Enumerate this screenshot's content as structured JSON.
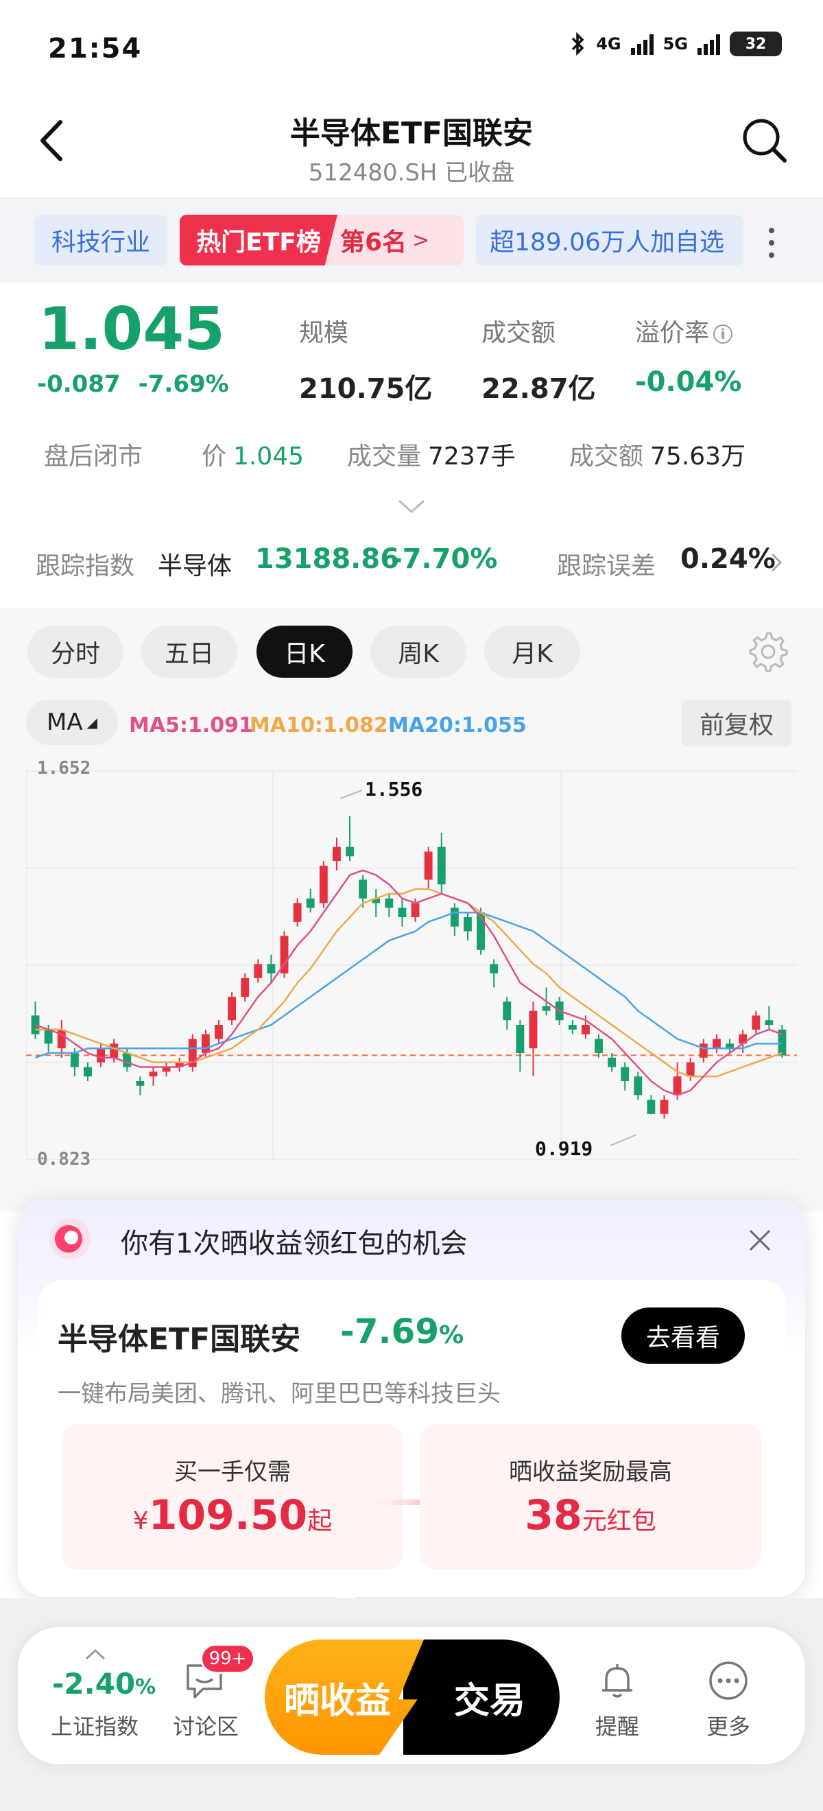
{
  "status": {
    "time": "21:54",
    "net1": "4G",
    "net2": "5G",
    "battery": "32"
  },
  "header": {
    "title": "半导体ETF国联安",
    "subtitle": "512480.SH 已收盘"
  },
  "tags": {
    "industry": "科技行业",
    "hot_label": "热门ETF榜",
    "rank": "第6名",
    "rank_arrow": ">",
    "watchers": "超189.06万人加自选"
  },
  "quote": {
    "price": "1.045",
    "change": "-0.087",
    "change_pct": "-7.69%",
    "scale_label": "规模",
    "scale_value": "210.75亿",
    "turnover_label": "成交额",
    "turnover_value": "22.87亿",
    "premium_label": "溢价率",
    "premium_value": "-0.04%"
  },
  "after_hours": {
    "title": "盘后闭市",
    "price_label": "价",
    "price_value": "1.045",
    "volume_label": "成交量",
    "volume_value": "7237手",
    "amount_label": "成交额",
    "amount_value": "75.63万"
  },
  "tracking": {
    "label": "跟踪指数",
    "index_name": "半导体",
    "index_value": "13188.86",
    "index_pct": "-7.70%",
    "error_label": "跟踪误差",
    "error_value": "0.24%"
  },
  "period_tabs": [
    {
      "label": "分时"
    },
    {
      "label": "五日"
    },
    {
      "label": "日K"
    },
    {
      "label": "周K"
    },
    {
      "label": "月K"
    }
  ],
  "ma_bar": {
    "button": "MA",
    "ma5": "MA5:1.091",
    "ma10": "MA10:1.082",
    "ma20": "MA20:1.055",
    "adjust": "前复权",
    "ma5_color": "#e0508a",
    "ma10_color": "#f0a94a",
    "ma20_color": "#4aa3e8"
  },
  "chart_labels": {
    "y_max": "1.652",
    "y_min": "0.823",
    "peak": "1.556",
    "trough": "0.919"
  },
  "chart_data": {
    "type": "candlestick",
    "ylim": [
      0.823,
      1.652
    ],
    "reference_price": 1.045,
    "candles": [
      {
        "o": 1.13,
        "c": 1.09,
        "h": 1.16,
        "l": 1.08
      },
      {
        "o": 1.1,
        "c": 1.07,
        "h": 1.11,
        "l": 1.05
      },
      {
        "o": 1.06,
        "c": 1.1,
        "h": 1.12,
        "l": 1.04
      },
      {
        "o": 1.05,
        "c": 1.02,
        "h": 1.06,
        "l": 1.0
      },
      {
        "o": 1.02,
        "c": 1.0,
        "h": 1.03,
        "l": 0.99
      },
      {
        "o": 1.03,
        "c": 1.06,
        "h": 1.07,
        "l": 1.02
      },
      {
        "o": 1.04,
        "c": 1.07,
        "h": 1.08,
        "l": 1.03
      },
      {
        "o": 1.05,
        "c": 1.02,
        "h": 1.06,
        "l": 1.01
      },
      {
        "o": 0.99,
        "c": 0.98,
        "h": 1.0,
        "l": 0.96
      },
      {
        "o": 1.0,
        "c": 1.01,
        "h": 1.02,
        "l": 0.98
      },
      {
        "o": 1.01,
        "c": 1.02,
        "h": 1.03,
        "l": 1.0
      },
      {
        "o": 1.02,
        "c": 1.03,
        "h": 1.04,
        "l": 1.01
      },
      {
        "o": 1.02,
        "c": 1.08,
        "h": 1.09,
        "l": 1.01
      },
      {
        "o": 1.05,
        "c": 1.09,
        "h": 1.1,
        "l": 1.04
      },
      {
        "o": 1.08,
        "c": 1.11,
        "h": 1.12,
        "l": 1.07
      },
      {
        "o": 1.12,
        "c": 1.17,
        "h": 1.18,
        "l": 1.11
      },
      {
        "o": 1.17,
        "c": 1.21,
        "h": 1.22,
        "l": 1.16
      },
      {
        "o": 1.21,
        "c": 1.24,
        "h": 1.25,
        "l": 1.2
      },
      {
        "o": 1.24,
        "c": 1.22,
        "h": 1.26,
        "l": 1.2
      },
      {
        "o": 1.22,
        "c": 1.3,
        "h": 1.31,
        "l": 1.21
      },
      {
        "o": 1.33,
        "c": 1.37,
        "h": 1.38,
        "l": 1.32
      },
      {
        "o": 1.38,
        "c": 1.36,
        "h": 1.4,
        "l": 1.35
      },
      {
        "o": 1.37,
        "c": 1.45,
        "h": 1.46,
        "l": 1.36
      },
      {
        "o": 1.46,
        "c": 1.49,
        "h": 1.51,
        "l": 1.44
      },
      {
        "o": 1.49,
        "c": 1.47,
        "h": 1.556,
        "l": 1.46
      },
      {
        "o": 1.42,
        "c": 1.38,
        "h": 1.43,
        "l": 1.36
      },
      {
        "o": 1.38,
        "c": 1.37,
        "h": 1.4,
        "l": 1.34
      },
      {
        "o": 1.38,
        "c": 1.36,
        "h": 1.39,
        "l": 1.34
      },
      {
        "o": 1.36,
        "c": 1.34,
        "h": 1.38,
        "l": 1.32
      },
      {
        "o": 1.34,
        "c": 1.37,
        "h": 1.38,
        "l": 1.33
      },
      {
        "o": 1.42,
        "c": 1.48,
        "h": 1.49,
        "l": 1.4
      },
      {
        "o": 1.49,
        "c": 1.41,
        "h": 1.52,
        "l": 1.39
      },
      {
        "o": 1.36,
        "c": 1.32,
        "h": 1.37,
        "l": 1.3
      },
      {
        "o": 1.34,
        "c": 1.31,
        "h": 1.35,
        "l": 1.29
      },
      {
        "o": 1.35,
        "c": 1.27,
        "h": 1.36,
        "l": 1.26
      },
      {
        "o": 1.24,
        "c": 1.22,
        "h": 1.25,
        "l": 1.19
      },
      {
        "o": 1.16,
        "c": 1.12,
        "h": 1.17,
        "l": 1.1
      },
      {
        "o": 1.11,
        "c": 1.05,
        "h": 1.12,
        "l": 1.01
      },
      {
        "o": 1.06,
        "c": 1.14,
        "h": 1.16,
        "l": 1.0
      },
      {
        "o": 1.15,
        "c": 1.14,
        "h": 1.19,
        "l": 1.13
      },
      {
        "o": 1.16,
        "c": 1.12,
        "h": 1.17,
        "l": 1.11
      },
      {
        "o": 1.11,
        "c": 1.1,
        "h": 1.12,
        "l": 1.09
      },
      {
        "o": 1.09,
        "c": 1.11,
        "h": 1.13,
        "l": 1.08
      },
      {
        "o": 1.08,
        "c": 1.05,
        "h": 1.09,
        "l": 1.04
      },
      {
        "o": 1.04,
        "c": 1.02,
        "h": 1.05,
        "l": 1.01
      },
      {
        "o": 1.02,
        "c": 0.99,
        "h": 1.03,
        "l": 0.97
      },
      {
        "o": 1.0,
        "c": 0.96,
        "h": 1.01,
        "l": 0.95
      },
      {
        "o": 0.95,
        "c": 0.92,
        "h": 0.96,
        "l": 0.919
      },
      {
        "o": 0.92,
        "c": 0.95,
        "h": 0.96,
        "l": 0.91
      },
      {
        "o": 0.96,
        "c": 1.0,
        "h": 1.03,
        "l": 0.95
      },
      {
        "o": 1.0,
        "c": 1.03,
        "h": 1.04,
        "l": 0.99
      },
      {
        "o": 1.04,
        "c": 1.07,
        "h": 1.08,
        "l": 1.03
      },
      {
        "o": 1.06,
        "c": 1.08,
        "h": 1.09,
        "l": 1.05
      },
      {
        "o": 1.07,
        "c": 1.06,
        "h": 1.08,
        "l": 1.05
      },
      {
        "o": 1.07,
        "c": 1.09,
        "h": 1.1,
        "l": 1.05
      },
      {
        "o": 1.1,
        "c": 1.13,
        "h": 1.14,
        "l": 1.09
      },
      {
        "o": 1.12,
        "c": 1.11,
        "h": 1.15,
        "l": 1.1
      },
      {
        "o": 1.1,
        "c": 1.045,
        "h": 1.11,
        "l": 1.04
      }
    ],
    "ma5": [
      1.11,
      1.1,
      1.09,
      1.07,
      1.05,
      1.04,
      1.04,
      1.03,
      1.02,
      1.02,
      1.02,
      1.02,
      1.03,
      1.05,
      1.06,
      1.09,
      1.13,
      1.17,
      1.2,
      1.24,
      1.28,
      1.31,
      1.35,
      1.39,
      1.43,
      1.44,
      1.43,
      1.41,
      1.38,
      1.37,
      1.38,
      1.39,
      1.38,
      1.37,
      1.34,
      1.3,
      1.25,
      1.2,
      1.18,
      1.16,
      1.14,
      1.13,
      1.12,
      1.1,
      1.08,
      1.05,
      1.02,
      0.99,
      0.97,
      0.96,
      0.97,
      1.0,
      1.03,
      1.05,
      1.07,
      1.09,
      1.1,
      1.09
    ],
    "ma10": [
      1.1,
      1.1,
      1.1,
      1.09,
      1.08,
      1.07,
      1.06,
      1.05,
      1.04,
      1.03,
      1.03,
      1.03,
      1.03,
      1.04,
      1.05,
      1.06,
      1.08,
      1.1,
      1.13,
      1.16,
      1.2,
      1.23,
      1.27,
      1.31,
      1.34,
      1.37,
      1.38,
      1.39,
      1.39,
      1.4,
      1.4,
      1.39,
      1.38,
      1.37,
      1.35,
      1.33,
      1.3,
      1.27,
      1.24,
      1.22,
      1.19,
      1.17,
      1.15,
      1.13,
      1.11,
      1.09,
      1.07,
      1.05,
      1.03,
      1.01,
      1.0,
      1.0,
      1.0,
      1.01,
      1.02,
      1.03,
      1.04,
      1.05
    ],
    "ma20": [
      1.04,
      1.05,
      1.05,
      1.05,
      1.06,
      1.06,
      1.06,
      1.06,
      1.06,
      1.06,
      1.06,
      1.06,
      1.06,
      1.06,
      1.07,
      1.08,
      1.09,
      1.1,
      1.11,
      1.13,
      1.15,
      1.17,
      1.19,
      1.21,
      1.23,
      1.25,
      1.27,
      1.29,
      1.3,
      1.31,
      1.33,
      1.34,
      1.35,
      1.35,
      1.35,
      1.34,
      1.33,
      1.32,
      1.31,
      1.29,
      1.27,
      1.25,
      1.23,
      1.21,
      1.19,
      1.17,
      1.14,
      1.12,
      1.1,
      1.08,
      1.07,
      1.06,
      1.06,
      1.06,
      1.06,
      1.07,
      1.07,
      1.07
    ]
  },
  "popup": {
    "header": "你有1次晒收益领红包的机会",
    "fund_name": "半导体ETF国联安",
    "fund_pct": "-7.69",
    "pct_sign": "%",
    "go_button": "去看看",
    "desc": "一键布局美团、腾讯、阿里巴巴等科技巨头",
    "left_label": "买一手仅需",
    "left_currency": "¥",
    "left_value": "109.50",
    "left_suffix": "起",
    "right_label": "晒收益奖励最高",
    "right_value": "38",
    "right_suffix": "元红包"
  },
  "bottom_bar": {
    "index_value": "-2.40",
    "index_sign": "%",
    "index_label": "上证指数",
    "forum_label": "讨论区",
    "forum_badge": "99+",
    "share_button": "晒收益",
    "trade_button": "交易",
    "remind_label": "提醒",
    "more_label": "更多"
  }
}
